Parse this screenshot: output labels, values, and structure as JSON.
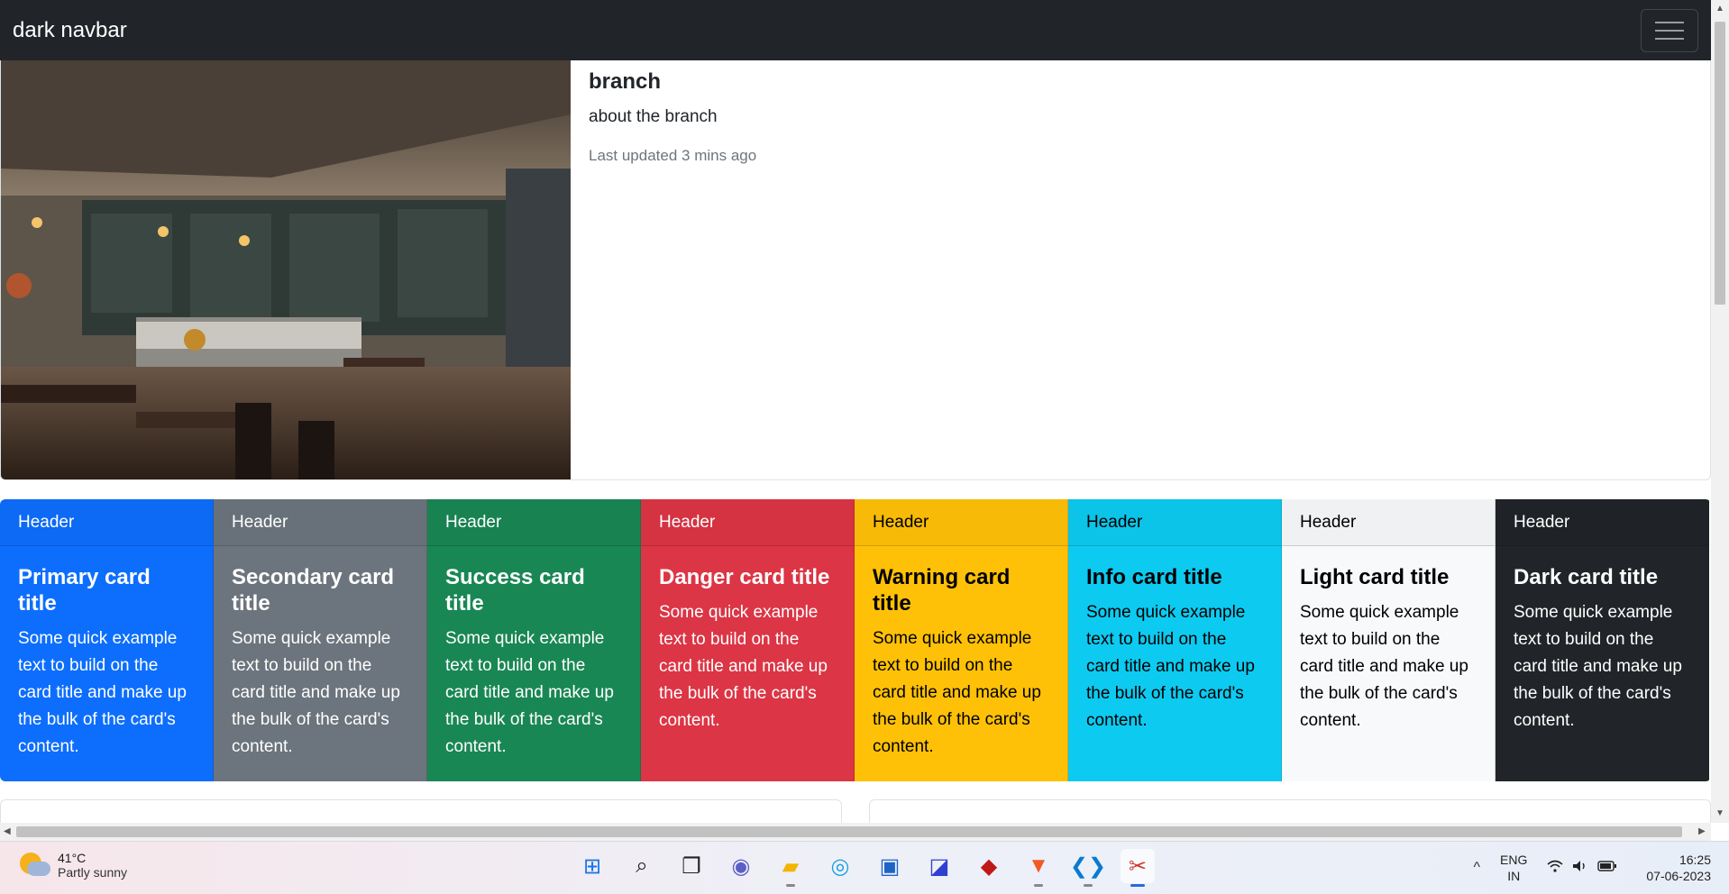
{
  "navbar": {
    "brand": "dark navbar",
    "toggler_icon": "hamburger-menu-icon"
  },
  "hero": {
    "image_alt": "cafe interior photo",
    "title": "branch",
    "text": "about the branch",
    "updated": "Last updated 3 mins ago"
  },
  "cards": [
    {
      "header": "Header",
      "title": "Primary card title",
      "text": "Some quick example text to build on the card title and make up the bulk of the card's content.",
      "bg": "#0d6efd",
      "fg": "#ffffff"
    },
    {
      "header": "Header",
      "title": "Secondary card title",
      "text": "Some quick example text to build on the card title and make up the bulk of the card's content.",
      "bg": "#6c757d",
      "fg": "#ffffff"
    },
    {
      "header": "Header",
      "title": "Success card title",
      "text": "Some quick example text to build on the card title and make up the bulk of the card's content.",
      "bg": "#198754",
      "fg": "#ffffff"
    },
    {
      "header": "Header",
      "title": "Danger card title",
      "text": "Some quick example text to build on the card title and make up the bulk of the card's content.",
      "bg": "#dc3545",
      "fg": "#ffffff"
    },
    {
      "header": "Header",
      "title": "Warning card title",
      "text": "Some quick example text to build on the card title and make up the bulk of the card's content.",
      "bg": "#ffc107",
      "fg": "#000000"
    },
    {
      "header": "Header",
      "title": "Info card title",
      "text": "Some quick example text to build on the card title and make up the bulk of the card's content.",
      "bg": "#0dcaf0",
      "fg": "#000000"
    },
    {
      "header": "Header",
      "title": "Light card title",
      "text": "Some quick example text to build on the card title and make up the bulk of the card's content.",
      "bg": "#f8f9fa",
      "fg": "#000000"
    },
    {
      "header": "Header",
      "title": "Dark card title",
      "text": "Some quick example text to build on the card title and make up the bulk of the card's content.",
      "bg": "#212529",
      "fg": "#ffffff"
    }
  ],
  "taskbar": {
    "weather": {
      "temp": "41°C",
      "desc": "Partly sunny",
      "icon": "partly-sunny-icon"
    },
    "apps": [
      {
        "name": "start-icon",
        "glyph": "⊞",
        "color": "#1a73e8",
        "active": false
      },
      {
        "name": "search-icon",
        "glyph": "⌕",
        "color": "#222222",
        "active": false
      },
      {
        "name": "task-view-icon",
        "glyph": "❐",
        "color": "#222222",
        "active": false
      },
      {
        "name": "chat-icon",
        "glyph": "◉",
        "color": "#5b5fc7",
        "active": false
      },
      {
        "name": "file-explorer-icon",
        "glyph": "▰",
        "color": "#f2b600",
        "active": false
      },
      {
        "name": "edge-browser-icon",
        "glyph": "◎",
        "color": "#1ba1e2",
        "active": false
      },
      {
        "name": "store-icon",
        "glyph": "▣",
        "color": "#1e64c8",
        "active": false
      },
      {
        "name": "editor-app-icon",
        "glyph": "◪",
        "color": "#2f3fd1",
        "active": false
      },
      {
        "name": "mcafee-icon",
        "glyph": "◆",
        "color": "#c01818",
        "active": false
      },
      {
        "name": "brave-browser-icon",
        "glyph": "▼",
        "color": "#f05a24",
        "active": false
      },
      {
        "name": "vscode-icon",
        "glyph": "❮❯",
        "color": "#0a7ad1",
        "active": false
      },
      {
        "name": "snipping-tool-icon",
        "glyph": "✂",
        "color": "#d0342c",
        "active": true
      }
    ],
    "tray": {
      "chevron": "^",
      "lang_top": "ENG",
      "lang_bottom": "IN",
      "wifi": "wifi-icon",
      "volume": "volume-icon",
      "battery": "battery-icon",
      "time": "16:25",
      "date": "07-06-2023"
    }
  }
}
